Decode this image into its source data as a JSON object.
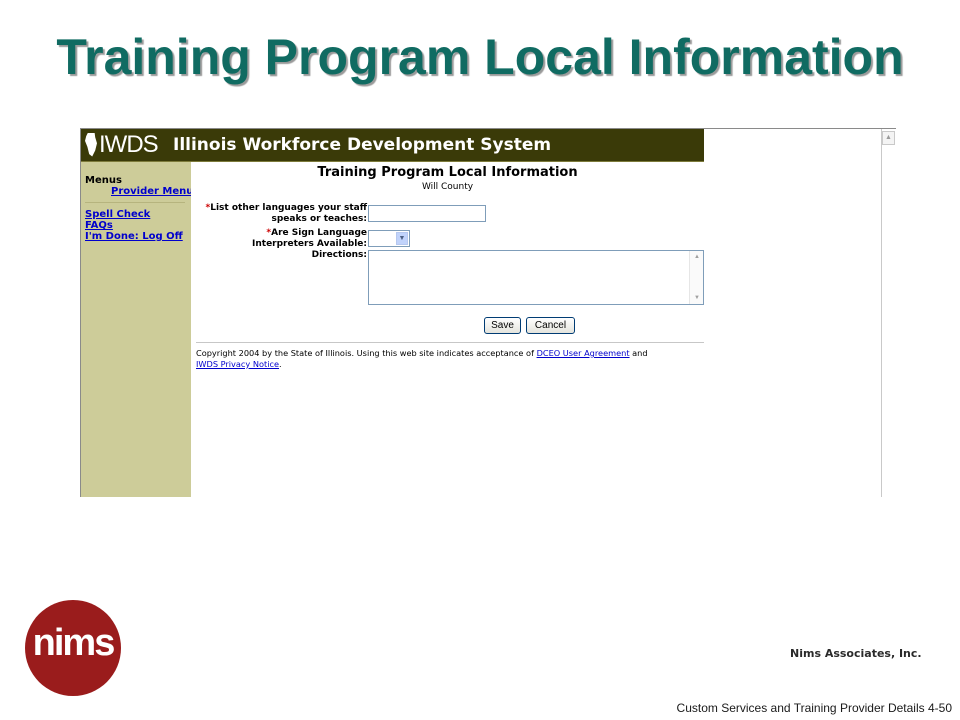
{
  "slide": {
    "title": "Training Program Local Information",
    "company": "Nims Associates, Inc.",
    "logo_text": "nims",
    "footer": "Custom Services and Training Provider Details 4-50"
  },
  "banner": {
    "logo_text": "IWDS",
    "title": "Illinois Workforce Development System"
  },
  "nav": {
    "heading": "Menus",
    "provider_menu": "Provider Menu",
    "spell_check": "Spell Check",
    "faqs": "FAQs",
    "logout": "I'm Done: Log Off"
  },
  "form": {
    "title": "Training Program Local Information",
    "subtitle": "Will County",
    "required_mark": "*",
    "languages_label_line1": "List other languages your staff",
    "languages_label_line2": "speaks or teaches:",
    "languages_value": "",
    "sign_label_line1": "Are Sign Language",
    "sign_label_line2": "Interpreters Available:",
    "sign_value": "",
    "directions_label": "Directions:",
    "directions_value": "",
    "save_label": "Save",
    "cancel_label": "Cancel"
  },
  "footer": {
    "copyright_text": "Copyright 2004 by the State of Illinois. Using this web site indicates acceptance of ",
    "agreement_link": "DCEO User Agreement",
    "and_text": " and",
    "privacy_link": "IWDS Privacy Notice",
    "period": "."
  },
  "colors": {
    "title_teal": "#106b62",
    "banner_bg": "#3a3a08",
    "nav_bg": "#cdcc99",
    "link_blue": "#0000cc",
    "nims_red": "#9a1c1c"
  }
}
